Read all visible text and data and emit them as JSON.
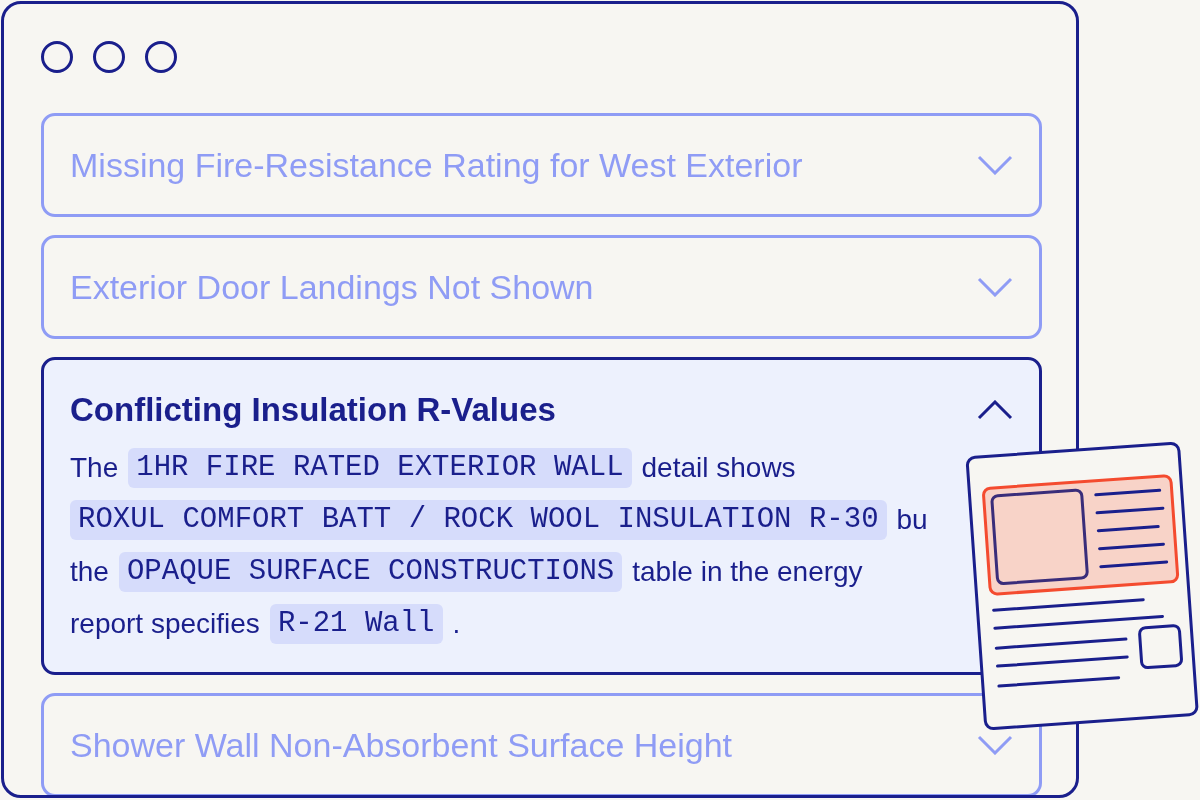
{
  "issues": [
    {
      "title": "Missing Fire-Resistance Rating for West Exterior",
      "expanded": false
    },
    {
      "title": "Exterior Door Landings Not Shown",
      "expanded": false
    },
    {
      "title": "Conflicting Insulation R-Values",
      "expanded": true,
      "body_lines": [
        [
          {
            "kind": "text",
            "text": "The"
          },
          {
            "kind": "code",
            "text": "1HR FIRE RATED EXTERIOR WALL"
          },
          {
            "kind": "text",
            "text": "detail shows"
          }
        ],
        [
          {
            "kind": "code",
            "text": "ROXUL COMFORT BATT / ROCK WOOL INSULATION R-30"
          },
          {
            "kind": "text",
            "text": "bu"
          }
        ],
        [
          {
            "kind": "text",
            "text": "the"
          },
          {
            "kind": "code",
            "text": "OPAQUE SURFACE CONSTRUCTIONS"
          },
          {
            "kind": "text",
            "text": "table in the energy"
          }
        ],
        [
          {
            "kind": "text",
            "text": "report specifies"
          },
          {
            "kind": "code",
            "text": "R-21 Wall"
          },
          {
            "kind": "text",
            "text": "."
          }
        ]
      ]
    },
    {
      "title": "Shower Wall Non-Absorbent Surface Height",
      "expanded": false
    }
  ]
}
